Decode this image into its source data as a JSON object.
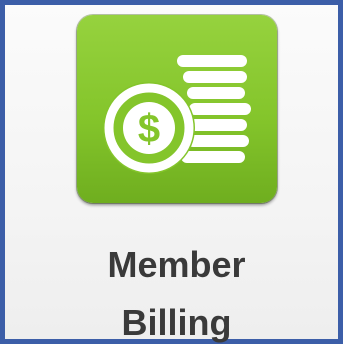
{
  "tile": {
    "label_line1": "Member",
    "label_line2": "Billing",
    "icon": "coins-dollar-icon"
  },
  "colors": {
    "icon_green": "#84c52b",
    "frame_border": "#3c5ea8",
    "label_text": "#3a3a3a"
  }
}
